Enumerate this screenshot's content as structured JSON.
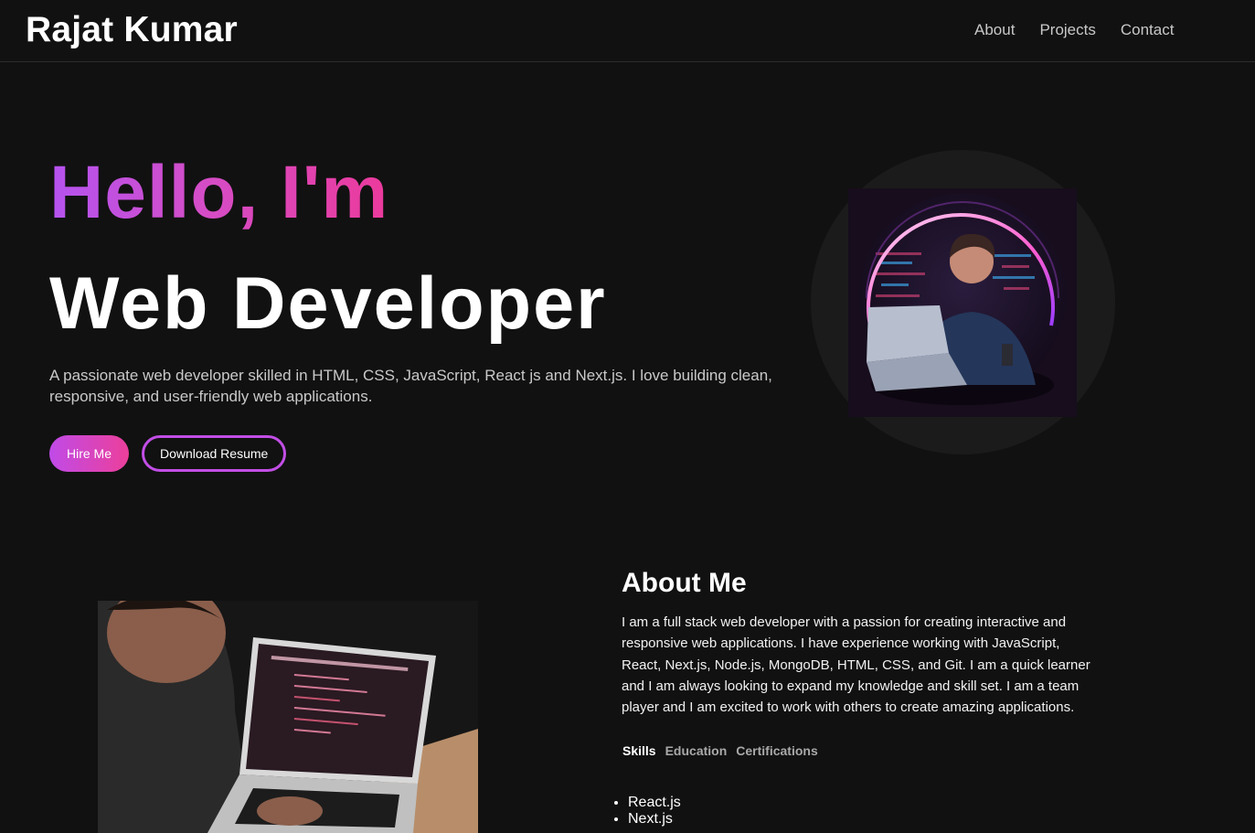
{
  "header": {
    "brand": "Rajat Kumar",
    "nav": [
      {
        "label": "About"
      },
      {
        "label": "Projects"
      },
      {
        "label": "Contact"
      }
    ]
  },
  "hero": {
    "greeting": "Hello, I'm",
    "role": "Web Developer",
    "intro": "A passionate web developer skilled in HTML, CSS, JavaScript, React js and Next.js. I love building clean, responsive, and user-friendly web applications.",
    "hire_label": "Hire Me",
    "resume_label": "Download Resume",
    "accent_from": "#b453f0",
    "accent_to": "#ec3a9c"
  },
  "about": {
    "title": "About Me",
    "text": "I am a full stack web developer with a passion for creating interactive and responsive web applications. I have experience working with JavaScript, React, Next.js, Node.js, MongoDB, HTML, CSS, and Git. I am a quick learner and I am always looking to expand my knowledge and skill set. I am a team player and I am excited to work with others to create amazing applications.",
    "tabs": [
      {
        "label": "Skills",
        "active": true
      },
      {
        "label": "Education",
        "active": false
      },
      {
        "label": "Certifications",
        "active": false
      }
    ],
    "skills": [
      "React.js",
      "Next.js"
    ]
  }
}
